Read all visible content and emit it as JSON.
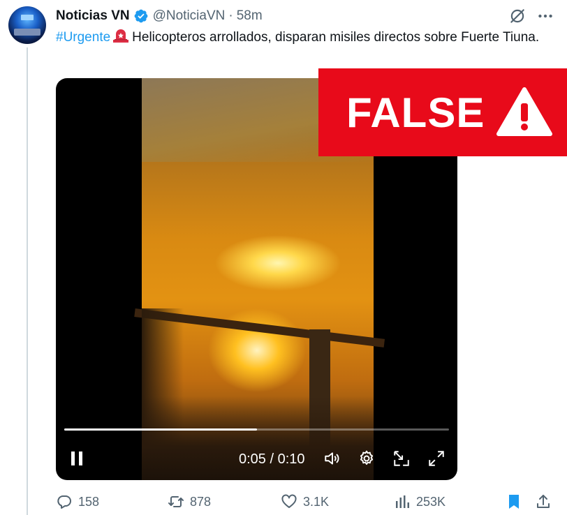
{
  "author": {
    "display_name": "Noticias VN",
    "handle": "@NoticiaVN",
    "separator": "·",
    "time": "58m"
  },
  "tweet": {
    "hashtag": "#Urgente",
    "text": "Helicopteros arrollados, disparan misiles directos sobre Fuerte Tiuna."
  },
  "video": {
    "time_readout": "0:05 / 0:10",
    "progress": 0.5
  },
  "badge": {
    "label": "FALSE",
    "color": "#e80a1a"
  },
  "actions": {
    "replies": "158",
    "reposts": "878",
    "likes": "3.1K",
    "views": "253K"
  },
  "colors": {
    "accent": "#1d9bf0",
    "muted": "#536471",
    "bookmark": "#1d9bf0"
  },
  "icons": {
    "verified": "verified-badge-icon",
    "grok": "grok-icon",
    "more": "more-icon",
    "siren": "rotating-light-icon",
    "pause": "pause-icon",
    "volume": "volume-icon",
    "settings": "gear-icon",
    "pip": "picture-in-picture-icon",
    "fullscreen": "fullscreen-icon",
    "reply": "reply-icon",
    "repost": "repost-icon",
    "like": "heart-icon",
    "views": "views-icon",
    "bookmark": "bookmark-icon",
    "share": "share-icon",
    "warning": "warning-icon"
  }
}
